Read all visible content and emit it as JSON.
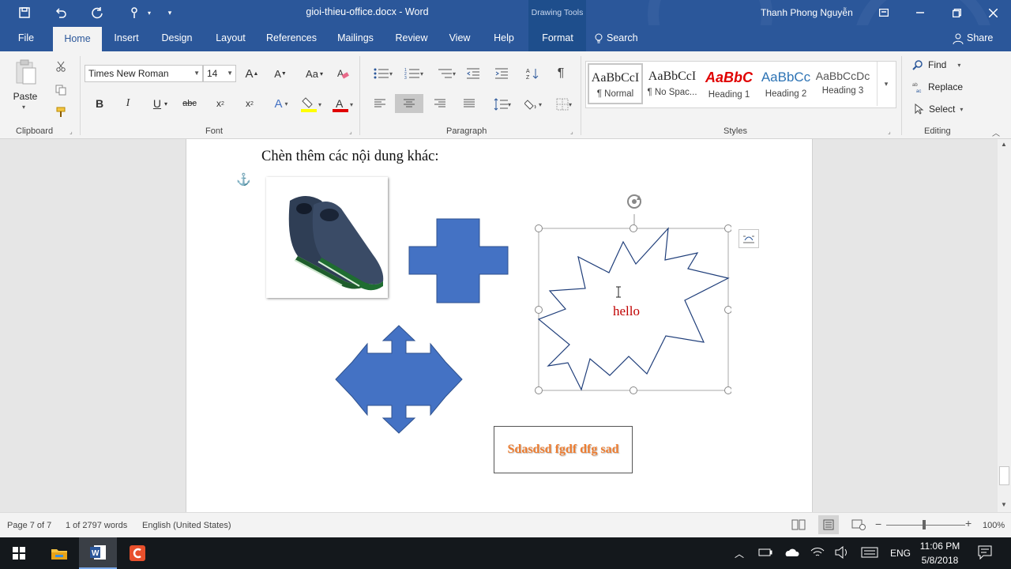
{
  "window": {
    "doc_title": "gioi-thieu-office.docx - Word",
    "contextual_group": "Drawing Tools",
    "user_name": "Thanh Phong Nguyễn"
  },
  "tabs": [
    "File",
    "Home",
    "Insert",
    "Design",
    "Layout",
    "References",
    "Mailings",
    "Review",
    "View",
    "Help",
    "Format"
  ],
  "search_label": "Search",
  "share_label": "Share",
  "ribbon": {
    "clipboard": {
      "paste_label": "Paste",
      "group_label": "Clipboard"
    },
    "font": {
      "font_name": "Times New Roman",
      "font_size": "14",
      "group_label": "Font"
    },
    "paragraph": {
      "group_label": "Paragraph"
    },
    "styles": {
      "group_label": "Styles",
      "items": [
        {
          "preview": "AaBbCcI",
          "name": "¶ Normal"
        },
        {
          "preview": "AaBbCcI",
          "name": "¶ No Spac..."
        },
        {
          "preview": "AaBbC",
          "name": "Heading 1"
        },
        {
          "preview": "AaBbCc",
          "name": "Heading 2"
        },
        {
          "preview": "AaBbCcDc",
          "name": "Heading 3"
        }
      ]
    },
    "editing": {
      "find": "Find",
      "replace": "Replace",
      "select": "Select",
      "group_label": "Editing"
    }
  },
  "document": {
    "heading_text": "Chèn thêm các nội dung khác:",
    "starburst_text": "hello",
    "textbox_text": "Sdasdsd fgdf dfg sad"
  },
  "status": {
    "page": "Page 7 of 7",
    "words": "1 of 2797 words",
    "language": "English (United States)",
    "zoom": "100%"
  },
  "taskbar": {
    "lang": "ENG",
    "time": "11:06 PM",
    "date": "5/8/2018"
  },
  "colors": {
    "word_blue": "#2b579a",
    "shape_blue": "#4472c4",
    "starburst_outline": "#1f3e7a",
    "hello_red": "#c00000",
    "wordart_orange": "#ed7d31"
  }
}
